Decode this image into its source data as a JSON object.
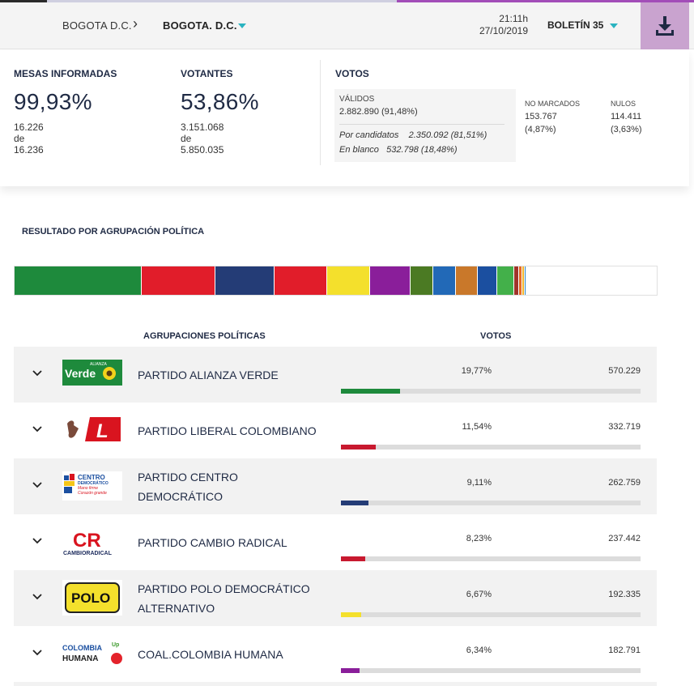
{
  "colors": {
    "accent_purple": "#a24db8",
    "download_bg": "#c9a3cf",
    "caret": "#2ab3c0",
    "navy_text": "#1f2a44"
  },
  "header": {
    "breadcrumb_1": "BOGOTA D.C.",
    "breadcrumb_2": "BOGOTA. D.C.",
    "time": "21:11h",
    "date": "27/10/2019",
    "bulletin": "BOLETÍN 35",
    "download_icon": "download-icon"
  },
  "summary": {
    "mesas": {
      "label": "MESAS INFORMADAS",
      "percent": "99,93%",
      "count": "16.226",
      "de": "de",
      "total": "16.236"
    },
    "votantes": {
      "label": "VOTANTES",
      "percent": "53,86%",
      "count": "3.151.068",
      "de": "de",
      "total": "5.850.035"
    },
    "votos": {
      "label": "VOTOS",
      "validos_label": "VÁLIDOS",
      "validos_value": "2.882.890 (91,48%)",
      "por_candidatos": "Por candidatos",
      "por_candidatos_value": "2.350.092 (81,51%)",
      "en_blanco": "En blanco",
      "en_blanco_value": "532.798 (18,48%)",
      "no_marcados_label": "NO MARCADOS",
      "no_marcados_value": "153.767",
      "no_marcados_pct": "(4,87%)",
      "nulos_label": "NULOS",
      "nulos_value": "114.411",
      "nulos_pct": "(3,63%)"
    }
  },
  "results": {
    "title": "RESULTADO POR AGRUPACIÓN POLÍTICA",
    "col_parties": "AGRUPACIONES POLÍTICAS",
    "col_votes": "VOTOS",
    "distribution": [
      {
        "share": 19.77,
        "color": "#1e8a3c"
      },
      {
        "share": 11.54,
        "color": "#e11d2a"
      },
      {
        "share": 9.11,
        "color": "#243c76"
      },
      {
        "share": 8.23,
        "color": "#e11d2a"
      },
      {
        "share": 6.67,
        "color": "#f4e02c"
      },
      {
        "share": 6.34,
        "color": "#8a1e9a"
      },
      {
        "share": 3.6,
        "color": "#4b7a23"
      },
      {
        "share": 3.5,
        "color": "#2269b7"
      },
      {
        "share": 3.4,
        "color": "#c9782a"
      },
      {
        "share": 3.0,
        "color": "#1b4fa0"
      },
      {
        "share": 2.6,
        "color": "#43b04a"
      },
      {
        "share": 0.8,
        "color": "#a0342a"
      },
      {
        "share": 0.5,
        "color": "#e56a25"
      },
      {
        "share": 0.4,
        "color": "#f2b32a"
      },
      {
        "share": 0.3,
        "color": "#2f86c8"
      },
      {
        "share": 20.24,
        "color": "#ffffff"
      }
    ],
    "parties": [
      {
        "name": "PARTIDO ALIANZA VERDE",
        "percent": "19,77%",
        "share": 19.77,
        "votes": "570.229",
        "color": "#1e8a3c",
        "logo_text": "Verde",
        "logo_small": "ALIANZA"
      },
      {
        "name": "PARTIDO LIBERAL COLOMBIANO",
        "percent": "11,54%",
        "share": 11.54,
        "votes": "332.719",
        "color": "#c8192f",
        "logo_text": "L"
      },
      {
        "name_line1": "PARTIDO CENTRO",
        "name_line2": "DEMOCRÁTICO",
        "percent": "9,11%",
        "share": 9.11,
        "votes": "262.759",
        "color": "#243c76",
        "logo_text": "CENTRO",
        "logo_text_2": "DEMOCRÁTICO",
        "logo_tagline_1": "Mano firme",
        "logo_tagline_2": "Corazón grande"
      },
      {
        "name": "PARTIDO CAMBIO RADICAL",
        "percent": "8,23%",
        "share": 8.23,
        "votes": "237.442",
        "color": "#c8192f",
        "logo_text": "CR",
        "logo_small": "CAMBIORADICAL"
      },
      {
        "name_line1": "PARTIDO POLO DEMOCRÁTICO",
        "name_line2": "ALTERNATIVO",
        "percent": "6,67%",
        "share": 6.67,
        "votes": "192.335",
        "color": "#f4e02c",
        "logo_text": "POLO"
      },
      {
        "name": "COAL.COLOMBIA HUMANA",
        "percent": "6,34%",
        "share": 6.34,
        "votes": "182.791",
        "color": "#8a1e9a",
        "logo_text": "COLOMBIA",
        "logo_text_2": "HUMANA",
        "logo_small": "Up"
      }
    ]
  }
}
